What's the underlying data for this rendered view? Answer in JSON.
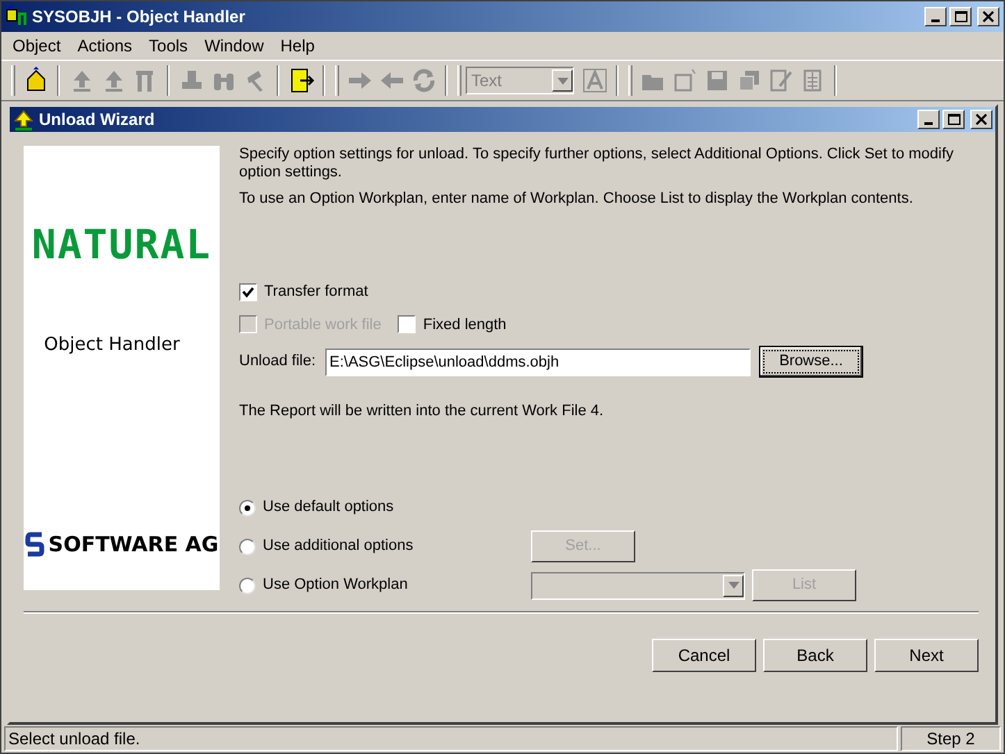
{
  "window": {
    "title": "SYSOBJH - Object Handler"
  },
  "menu": [
    "Object",
    "Actions",
    "Tools",
    "Window",
    "Help"
  ],
  "toolbar": {
    "groups": [
      [
        {
          "disabled": false
        }
      ],
      [
        {
          "disabled": true
        },
        {
          "disabled": true
        },
        {
          "disabled": true
        }
      ],
      [
        {
          "disabled": true
        },
        {
          "disabled": true
        },
        {
          "disabled": true
        }
      ],
      [
        {
          "disabled": false
        }
      ],
      [
        {
          "disabled": true
        },
        {
          "disabled": true
        },
        {
          "disabled": true
        }
      ]
    ],
    "combo": {
      "value": "Text",
      "disabled": true
    },
    "font_button": {
      "disabled": true
    },
    "file_group": [
      {
        "disabled": true
      },
      {
        "disabled": true
      },
      {
        "disabled": true
      },
      {
        "disabled": true
      },
      {
        "disabled": true
      },
      {
        "disabled": true
      }
    ]
  },
  "wizard": {
    "title": "Unload Wizard",
    "logo_panel": {
      "product": "NATURAL",
      "caption": "Object Handler",
      "vendor": "SOFTWARE AG"
    },
    "intro": [
      "Specify option settings for unload. To specify further options, select Additional Options. Click Set to modify option settings.",
      "To use an Option Workplan, enter name of Workplan. Choose List to display the  Workplan contents."
    ],
    "checkboxes": [
      {
        "label": "Transfer format",
        "checked": true,
        "disabled": false
      },
      {
        "label": "Portable work file",
        "checked": false,
        "disabled": true
      },
      {
        "label": "Fixed length",
        "checked": false,
        "disabled": false
      }
    ],
    "unload_file": {
      "label": "Unload file:",
      "value": "E:\\ASG\\Eclipse\\unload\\ddms.objh",
      "button": "Browse..."
    },
    "report_note": "The Report will be written into the current Work File 4.",
    "options": [
      {
        "label": "Use default options",
        "selected": true
      },
      {
        "label": "Use additional options",
        "selected": false,
        "button": {
          "label": "Set...",
          "disabled": true
        }
      },
      {
        "label": "Use Option Workplan",
        "selected": false,
        "combo": {
          "disabled": true
        },
        "button": {
          "label": "List",
          "disabled": true
        }
      }
    ],
    "buttons": [
      "Cancel",
      "Back",
      "Next"
    ]
  },
  "status_bar": {
    "message": "Select unload file.",
    "step": "Step 2"
  }
}
